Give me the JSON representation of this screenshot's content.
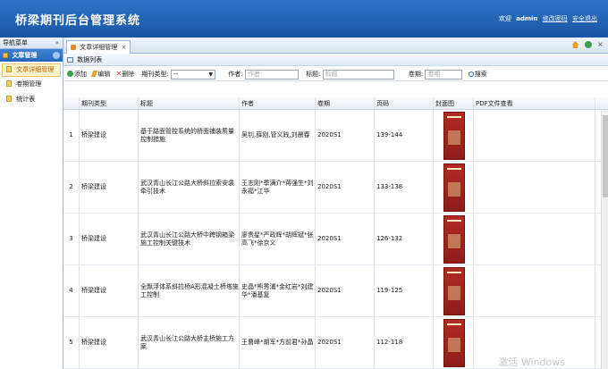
{
  "header": {
    "title": "桥梁期刊后台管理系统",
    "welcome": "欢迎",
    "user": "admin",
    "change_password": "修改密码",
    "logout": "安全退出",
    "bg_color": "#1f5fae"
  },
  "sidebar": {
    "nav_title": "导航菜单",
    "collapse": "«",
    "group": "文章管理",
    "items": [
      {
        "label": "文章详细管理",
        "active": true
      },
      {
        "label": "卷期管理",
        "active": false
      },
      {
        "label": "统计表",
        "active": false
      }
    ]
  },
  "tab": {
    "label": "文章详细管理",
    "close": "×"
  },
  "tab_tools": {
    "close_all": "×"
  },
  "panel": {
    "title": "数据列表"
  },
  "toolbar": {
    "add": "添加",
    "edit": "编辑",
    "delete": "删除",
    "delete_icon": "✕",
    "type_label": "期刊类型:",
    "type_value": "--",
    "author_label": "作者:",
    "author_placeholder": "作者",
    "title_label": "标题:",
    "title_placeholder": "标题",
    "issue_label": "卷期:",
    "issue_placeholder": "卷期",
    "search": "搜索"
  },
  "columns": {
    "type": "期刊类型",
    "title": "标题",
    "author": "作者",
    "issue": "卷期",
    "pages": "页码",
    "cover": "封面图",
    "pdf": "PDF文件查看"
  },
  "rows": [
    {
      "num": "1",
      "type": "桥梁建设",
      "title": "基于路面管控系统的桥面铺装质量控制措施",
      "author": "吴钊,薛刚,管义践,刘晨春",
      "issue": "2020S1",
      "pages": "139-144"
    },
    {
      "num": "2",
      "type": "桥梁建设",
      "title": "武汉青山长江公路大桥斜拉索安装牵引技术",
      "author": "王志刚*季满介*蒋强生*刘永福*江华",
      "issue": "2020S1",
      "pages": "133-138"
    },
    {
      "num": "3",
      "type": "桥梁建设",
      "title": "武汉青山长江公路大桥中跨钢箱梁施工控制关键技术",
      "author": "廖贵星*严政辉*胡辉斌*张高飞*徐京义",
      "issue": "2020S1",
      "pages": "126-132"
    },
    {
      "num": "4",
      "type": "桥梁建设",
      "title": "全飘浮体系斜拉桥A形混凝土桥塔施工控制",
      "author": "史晶*熊秀浦*金红岩*刘建华*潘基复",
      "issue": "2020S1",
      "pages": "119-125"
    },
    {
      "num": "5",
      "type": "桥梁建设",
      "title": "武汉青山长江公路大桥主桥施工方案",
      "author": "王曹峰*胡军*方前君*孙晶",
      "issue": "2020S1",
      "pages": "112-118"
    }
  ],
  "watermark": "激活 Windows"
}
